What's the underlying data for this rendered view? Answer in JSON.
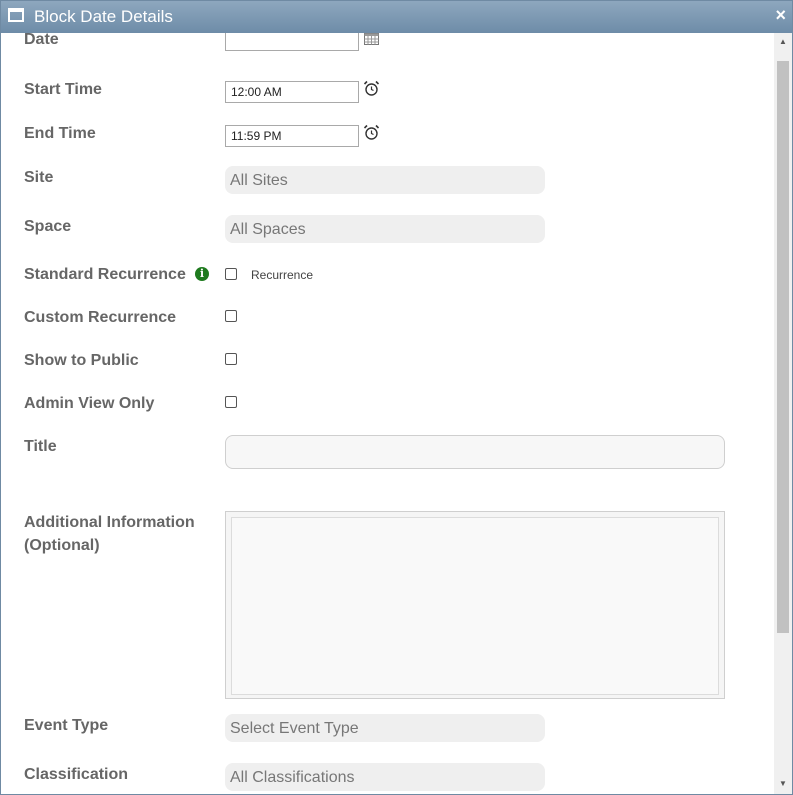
{
  "window": {
    "title": "Block Date Details",
    "close_glyph": "×"
  },
  "form": {
    "date_label": "Date",
    "date_value": "",
    "start_time_label": "Start Time",
    "start_time_value": "12:00 AM",
    "end_time_label": "End Time",
    "end_time_value": "11:59 PM",
    "site_label": "Site",
    "site_value": "All Sites",
    "space_label": "Space",
    "space_value": "All Spaces",
    "standard_recurrence_label": "Standard Recurrence",
    "recurrence_checkbox_label": "Recurrence",
    "custom_recurrence_label": "Custom Recurrence",
    "show_to_public_label": "Show to Public",
    "admin_view_only_label": "Admin View Only",
    "title_label": "Title",
    "title_value": "",
    "additional_info_label_line1": "Additional Information",
    "additional_info_label_line2": "(Optional)",
    "additional_info_value": "",
    "event_type_label": "Event Type",
    "event_type_value": "Select Event Type",
    "classification_label": "Classification",
    "classification_value": "All Classifications"
  },
  "icons": {
    "window": "window-icon",
    "close": "close-icon",
    "calendar": "calendar-icon",
    "alarm": "alarm-clock-icon",
    "info": "info-icon"
  },
  "colors": {
    "titlebar": "#7b97b2",
    "label_text": "#666666",
    "pill_bg": "#efefef",
    "info_green": "#1e7a1e"
  }
}
